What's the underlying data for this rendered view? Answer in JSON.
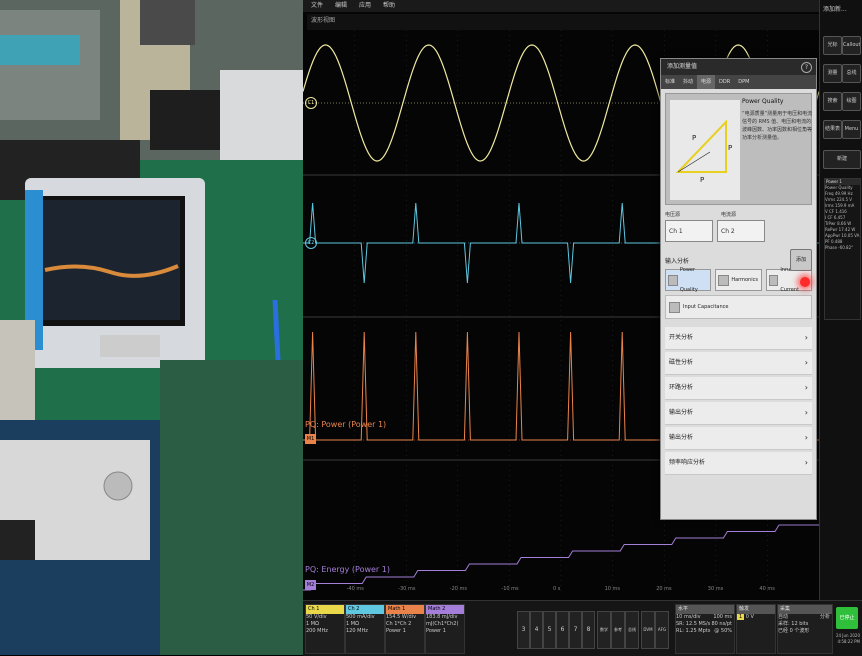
{
  "menu": [
    "文件",
    "编辑",
    "应用",
    "帮助"
  ],
  "waveform_view_label": "波形视图",
  "traces": {
    "ch1_tag": "C1",
    "ch2_tag": "C2",
    "math_tag": "M1",
    "power_label": "PQ: Power (Power 1)",
    "energy_label": "PQ: Energy (Power 1)",
    "energy_tag": "M2"
  },
  "dialog": {
    "title": "添加测量值",
    "help": "?",
    "tabs": [
      "标准",
      "抖动",
      "电源",
      "DDR",
      "DPM"
    ],
    "active_tab": "电源",
    "pq_heading": "Power Quality",
    "pq_description": "“电源质量”测量用于电压和电流信号的 RMS 值、电压和电流的波峰因数、功率因数和相位角等功率分析测量值。",
    "pq_diagram": {
      "p_app": "P",
      "p_true": "P",
      "p_react": "P"
    },
    "source_labels": [
      "电压源",
      "电流源"
    ],
    "voltage_source": "Ch 1",
    "current_source": "Ch 2",
    "add_label": "添加",
    "section_label": "输入分析",
    "types": [
      "Power Quality",
      "Harmonics",
      "Inrush Current"
    ],
    "input_cap": "Input Capacitance",
    "categories": [
      "开关分析",
      "磁性分析",
      "环路分析",
      "输出分析",
      "输出分析",
      "频率响应分析"
    ]
  },
  "right_panel": {
    "title": "添加新...",
    "buttons": [
      "光标",
      "Callout",
      "测量",
      "总线",
      "搜索",
      "绘图",
      "结果表",
      "Menu",
      "新建"
    ]
  },
  "meas_panel": {
    "header": "Power 1",
    "lines": [
      "Power Quality",
      "Freq 49.99 Hz",
      "Vrms 224.5 V",
      "Irms 159.9 mA",
      "V CF 1.416",
      "I CF 6.457",
      "TrPwr 8.66 W",
      "RePwr 17.42 W",
      "AppPwr 10.05 VA",
      "PF 0.488",
      "Phase -60.82°"
    ]
  },
  "time_ticks": [
    "-40 ms",
    "-30 ms",
    "-20 ms",
    "-10 ms",
    "0 s",
    "10 ms",
    "20 ms",
    "30 ms",
    "40 ms"
  ],
  "bottom": {
    "ch1": {
      "head": "Ch 1",
      "l1": "50 V/div",
      "l2": "1 MΩ",
      "l3": "200 MHz"
    },
    "ch2": {
      "head": "Ch 2",
      "l1": "500 mA/div",
      "l2": "1 MΩ",
      "l3": "120 MHz"
    },
    "math1": {
      "head": "Math 1",
      "l1": "154.5 W/div",
      "l2": "Ch 1*Ch 2",
      "l3": "Power 1"
    },
    "math2": {
      "head": "Math 2",
      "l1": "183.8 mJ/div",
      "l2": "mJ(Ch1*Ch2)",
      "l3": "Power 1"
    },
    "nums": [
      "3",
      "4",
      "5",
      "6",
      "7",
      "8"
    ],
    "extra": [
      "数学",
      "参考",
      "总线",
      "DVM",
      "AFG"
    ],
    "horizontal": {
      "title": "水平",
      "l1": "10 ms/div",
      "l2": "SR: 12.5 MS/s",
      "l3": "RL: 1.25 Mpts",
      "r1": "100 ms",
      "r2": "80 ns/pt",
      "r3": "@ 50%"
    },
    "trigger": {
      "title": "触发",
      "l1": "1",
      "l2": "0 V"
    },
    "acq": {
      "title": "采集",
      "l1": "自动",
      "l2": "采样: 12 bits",
      "l3": "已经 0 个波形",
      "r1": "分析"
    },
    "run": "已停止",
    "date": "24 Jun 2020",
    "time": "4:58:22 PM"
  }
}
